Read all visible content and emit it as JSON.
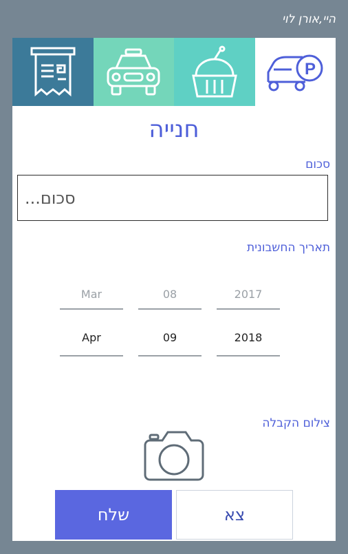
{
  "greeting": "היי,אורן לוי",
  "tabs": [
    {
      "name": "receipt",
      "icon": "receipt-icon"
    },
    {
      "name": "taxi",
      "icon": "taxi-icon"
    },
    {
      "name": "food",
      "icon": "cupcake-icon"
    },
    {
      "name": "parking",
      "icon": "parking-car-icon",
      "selected": true
    }
  ],
  "form": {
    "title": "חנייה",
    "amount_label": "סכום",
    "amount_placeholder": "סכום...",
    "date_label": "תאריך החשבונית",
    "date_picker": {
      "month": {
        "prev": "Mar",
        "current": "Apr"
      },
      "day": {
        "prev": "08",
        "current": "09"
      },
      "year": {
        "prev": "2017",
        "current": "2018"
      }
    },
    "photo_label": "צילום הקבלה"
  },
  "buttons": {
    "send": "שלח",
    "exit": "צא"
  },
  "colors": {
    "background": "#768693",
    "accent": "#4e5fd9",
    "send_button": "#5a67e0"
  }
}
